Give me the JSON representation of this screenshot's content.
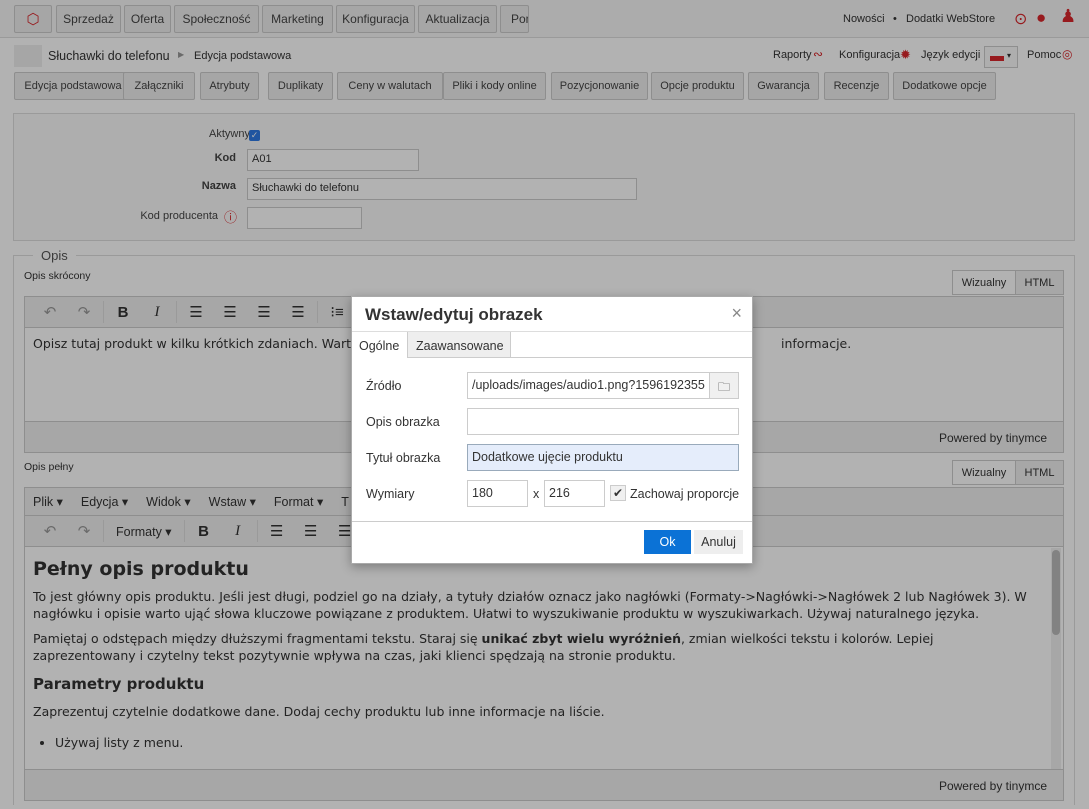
{
  "topnav": {
    "items": [
      "Sprzedaż",
      "Oferta",
      "Społeczność",
      "Marketing",
      "Konfiguracja",
      "Aktualizacja",
      "Pomoc"
    ],
    "links": [
      "Nowości",
      "Dodatki WebStore"
    ],
    "separator": "•"
  },
  "breadcrumb": {
    "product": "Słuchawki do telefonu",
    "current": "Edycja podstawowa"
  },
  "tools": {
    "reports": "Raporty",
    "config": "Konfiguracja",
    "lang": "Język edycji",
    "help": "Pomoc"
  },
  "tabs": [
    "Edycja podstawowa",
    "Załączniki",
    "Atrybuty",
    "Duplikaty",
    "Ceny w walutach",
    "Pliki i kody online",
    "Pozycjonowanie",
    "Opcje produktu",
    "Gwarancja",
    "Recenzje",
    "Dodatkowe opcje"
  ],
  "form": {
    "active_label": "Aktywny",
    "active": true,
    "code_label": "Kod",
    "code": "A01",
    "name_label": "Nazwa",
    "name": "Słuchawki do telefonu",
    "producer_code_label": "Kod producenta",
    "producer_code": ""
  },
  "desc": {
    "legend": "Opis",
    "short_label": "Opis skrócony",
    "full_label": "Opis pełny",
    "tab_visual": "Wizualny",
    "tab_html": "HTML",
    "short_text": "Opisz tutaj produkt w kilku krótkich zdaniach. Warto",
    "short_text_tail": "informacje.",
    "powered": "Powered by tinymce",
    "menu": [
      "Plik ▾",
      "Edycja ▾",
      "Widok ▾",
      "Wstaw ▾",
      "Format ▾",
      "T"
    ],
    "formats": "Formaty ▾",
    "full": {
      "h1": "Pełny opis produktu",
      "p1": "To jest główny opis produktu. Jeśli jest długi, podziel go na działy, a tytuły działów oznacz jako nagłówki (Formaty->Nagłówki->Nagłówek 2 lub Nagłówek 3). W nagłówku i opisie warto ująć słowa kluczowe powiązane z produktem. Ułatwi to wyszukiwanie produktu w wyszukiwarkach. Używaj naturalnego języka.",
      "p2a": "Pamiętaj o odstępach między dłuższymi fragmentami tekstu. Staraj się ",
      "p2b": "unikać zbyt wielu wyróżnień",
      "p2c": ", zmian wielkości tekstu i kolorów. Lepiej zaprezentowany i czytelny tekst pozytywnie wpływa na czas, jaki klienci spędzają na stronie produktu.",
      "h2": "Parametry produktu",
      "p3": "Zaprezentuj czytelnie dodatkowe dane. Dodaj cechy produktu lub inne informacje na liście.",
      "li1": "Używaj listy z menu."
    }
  },
  "modal": {
    "title": "Wstaw/edytuj obrazek",
    "tabs": [
      "Ogólne",
      "Zaawansowane"
    ],
    "source_label": "Źródło",
    "source": "/uploads/images/audio1.png?1596192355",
    "alt_label": "Opis obrazka",
    "alt": "",
    "title_label": "Tytuł obrazka",
    "title_value": "Dodatkowe ujęcie produktu",
    "dims_label": "Wymiary",
    "width": "180",
    "height": "216",
    "x": "x",
    "keep_label": "Zachowaj proporcje",
    "keep": true,
    "ok": "Ok",
    "cancel": "Anuluj"
  },
  "colors": {
    "accent": "#d9262b",
    "ok_button": "#0b72d6"
  }
}
